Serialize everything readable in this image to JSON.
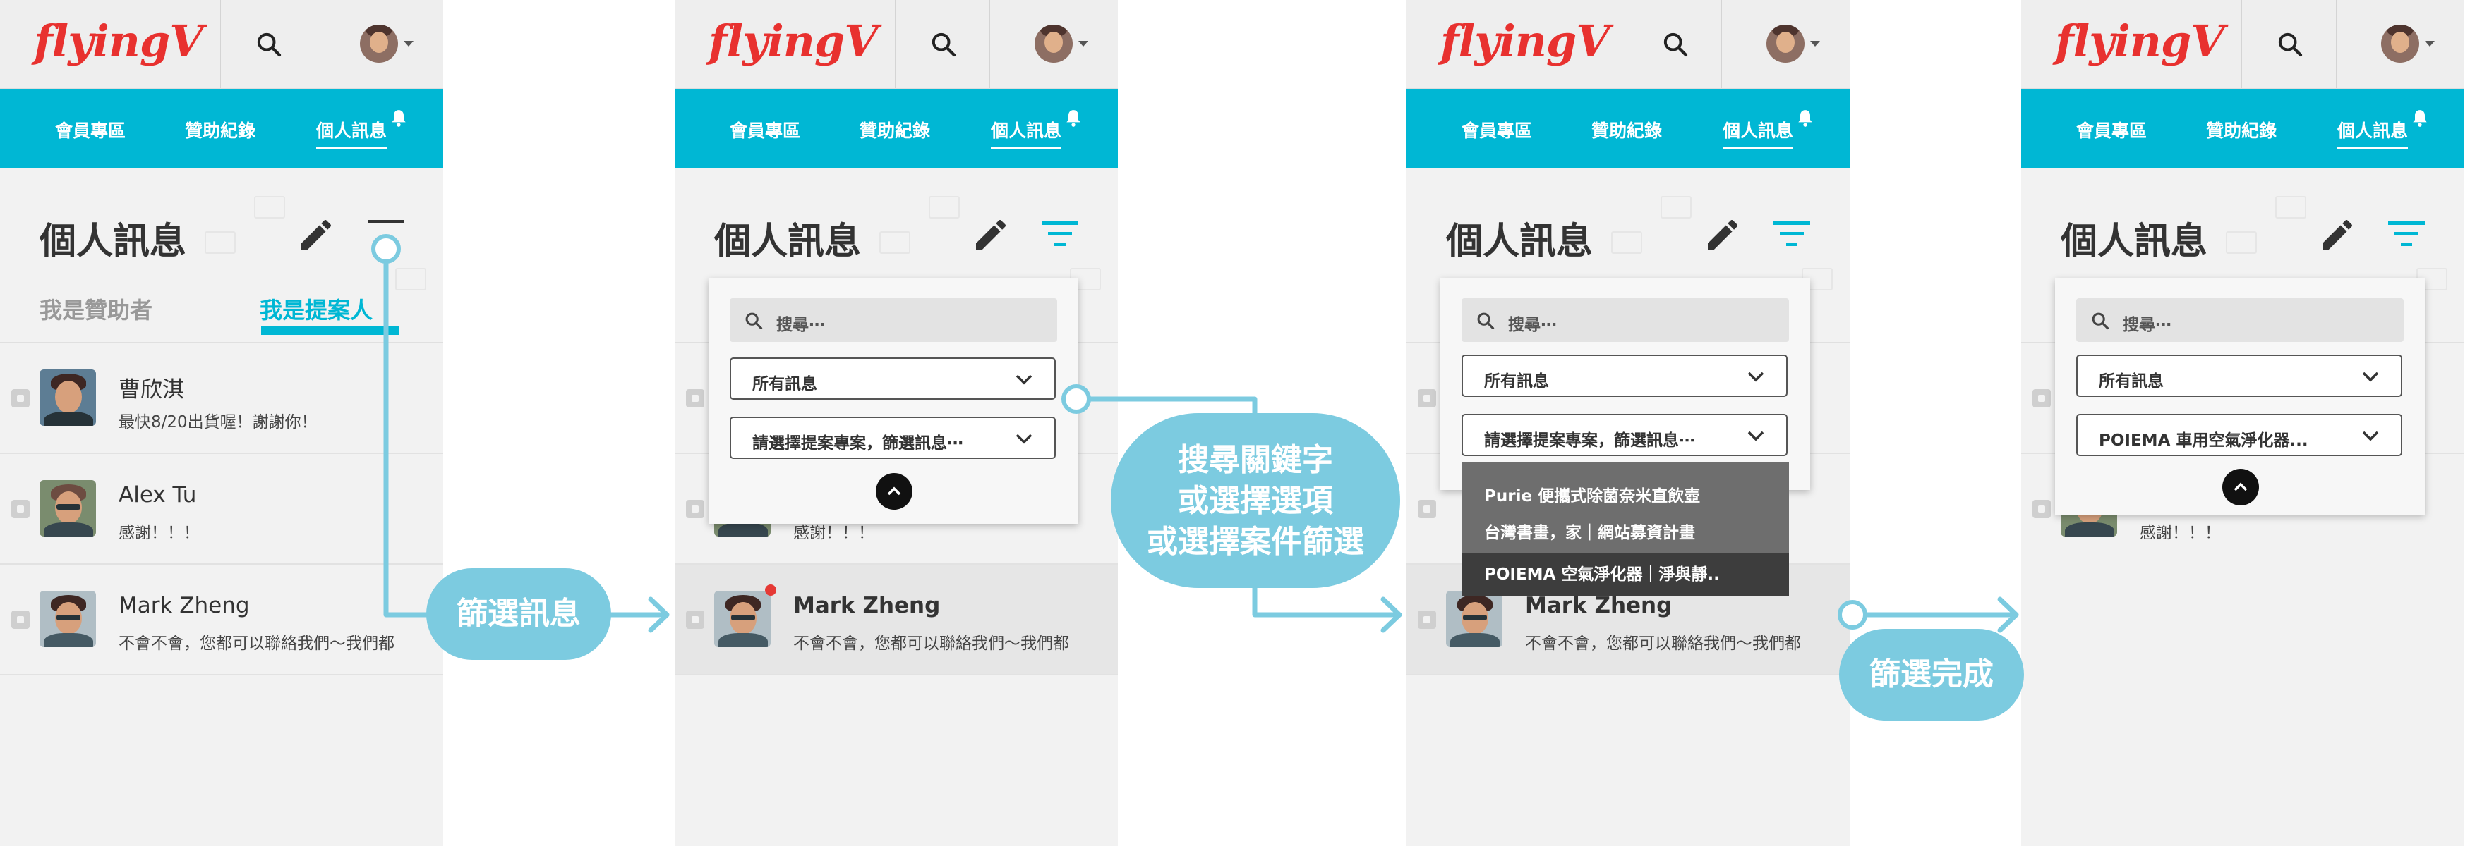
{
  "app": {
    "logo": "flyingV",
    "nav": [
      "會員專區",
      "贊助紀錄",
      "個人訊息"
    ],
    "page_title": "個人訊息"
  },
  "tabs": {
    "sponsor": "我是贊助者",
    "proposer": "我是提案人"
  },
  "conversations": [
    {
      "name": "曹欣淇",
      "message": "最快8/20出貨喔！謝謝你！"
    },
    {
      "name": "Alex Tu",
      "message": "感謝！！！"
    },
    {
      "name": "Mark Zheng",
      "message": "不會不會，您都可以聯絡我們～我們都"
    }
  ],
  "filter": {
    "search_placeholder": "搜尋⋯",
    "message_filter": "所有訊息",
    "project_placeholder": "請選擇提案專案，篩選訊息⋯",
    "dropdown_items": [
      {
        "text": "Purie 便攜式除菌奈米直飲壺",
        "tone": "normal"
      },
      {
        "text": "台灣書畫，家｜網站募資計畫",
        "tone": "normal"
      },
      {
        "text": "POIEMA 空氣淨化器｜淨與靜..",
        "tone": "dark"
      }
    ],
    "selected_project": "POIEMA 車用空氣淨化器..."
  },
  "annotations": {
    "step1": "篩選訊息",
    "step2": [
      "搜尋關鍵字",
      "或選擇選項",
      "或選擇案件篩選"
    ],
    "step3": "篩選完成"
  },
  "colors": {
    "accent": "#00b7d4",
    "logo": "#e8312f",
    "bubble": "#7ccbe0",
    "unread": "#e53935"
  }
}
